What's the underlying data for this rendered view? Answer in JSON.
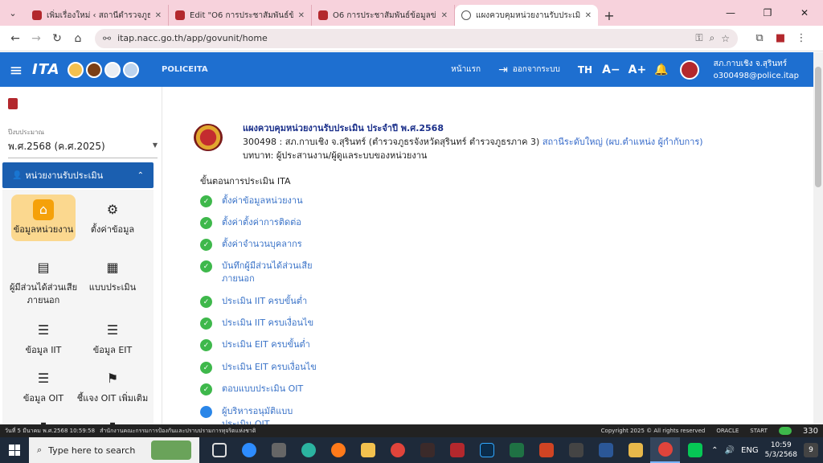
{
  "browser": {
    "tabs": [
      {
        "title": "เพิ่มเรื่องใหม่ ‹ สถานีตำรวจภูธรกาบเชิง",
        "active": false
      },
      {
        "title": "Edit \"O6 การประชาสัมพันธ์ข้อมูลข่าวสาร",
        "active": false
      },
      {
        "title": "O6 การประชาสัมพันธ์ข้อมูลข่าวสาร",
        "active": false
      },
      {
        "title": "แผงควบคุมหน่วยงานรับประเมิน - ITA",
        "active": true
      }
    ],
    "url": "itap.nacc.go.th/app/govunit/home"
  },
  "header": {
    "brand": "POLICEITA",
    "logo_text": "ITA",
    "home_link": "หน้าแรก",
    "logout_link": "ออกจากระบบ",
    "lang": "TH",
    "font_decrease": "A−",
    "font_increase": "A+",
    "user_name": "สภ.กาบเชิง จ.สุรินทร์",
    "user_email": "o300498@police.itap"
  },
  "sidebar": {
    "budget_label": "ปีงบประมาณ",
    "budget_value": "พ.ศ.2568 (ค.ศ.2025)",
    "panel_title": "หน่วยงานรับประเมิน",
    "items": [
      {
        "label": "ข้อมูลหน่วยงาน",
        "icon": "home-icon",
        "glyph": "⌂"
      },
      {
        "label": "ตั้งค่าข้อมูล",
        "icon": "settings-icon",
        "glyph": "⚙"
      },
      {
        "label": "ผู้มีส่วนได้ส่วนเสีย ภายนอก",
        "icon": "store-icon",
        "glyph": "▤"
      },
      {
        "label": "แบบประเมิน",
        "icon": "qr-icon",
        "glyph": "▦"
      },
      {
        "label": "ข้อมูล IIT",
        "icon": "checklist-icon",
        "glyph": "☰"
      },
      {
        "label": "ข้อมูล EIT",
        "icon": "checklist-icon",
        "glyph": "☰"
      },
      {
        "label": "ข้อมูล OIT",
        "icon": "checklist-icon",
        "glyph": "☰"
      },
      {
        "label": "ชี้แจง OIT เพิ่มเติม",
        "icon": "flag-icon",
        "glyph": "⚑"
      }
    ]
  },
  "main": {
    "title": "แผงควบคุมหน่วยงานรับประเมิน ประจำปี พ.ศ.2568",
    "unit_code_line": "300498 : สภ.กาบเชิง จ.สุรินทร์ (ตำรวจภูธรจังหวัดสุรินทร์ ตำรวจภูธรภาค 3)",
    "unit_type_link": "สถานีระดับใหญ่ (ผบ.ตำแหน่ง ผู้กำกับการ)",
    "role_line": "บทบาท: ผู้ประสานงาน/ผู้ดูแลระบบของหน่วยงาน",
    "steps_heading": "ขั้นตอนการประเมิน ITA",
    "steps": [
      {
        "label": "ตั้งค่าข้อมูลหน่วยงาน",
        "status": "done"
      },
      {
        "label": "ตั้งค่าตั้งค่าการติดต่อ",
        "status": "done"
      },
      {
        "label": "ตั้งค่าจำนวนบุคลากร",
        "status": "done"
      },
      {
        "label": "บันทึกผู้มีส่วนได้ส่วนเสีย ภายนอก",
        "status": "done"
      },
      {
        "label": "ประเมิน IIT ครบขั้นต่ำ",
        "status": "done"
      },
      {
        "label": "ประเมิน IIT ครบเงื่อนไข",
        "status": "done"
      },
      {
        "label": "ประเมิน EIT ครบขั้นต่ำ",
        "status": "done"
      },
      {
        "label": "ประเมิน EIT ครบเงื่อนไข",
        "status": "done"
      },
      {
        "label": "ตอบแบบประเมิน OIT",
        "status": "done"
      },
      {
        "label": "ผู้บริหารอนุมัติแบบประเมิน OIT",
        "status": "pending"
      }
    ]
  },
  "statusbar": {
    "left": "วันที่ 5 มีนาคม พ.ศ.2568 10:59:58",
    "org": "สำนักงานคณะกรรมการป้องกันและปราบปรามการทุจริตแห่งชาติ",
    "copyright": "Copyright 2025 © All rights reserved",
    "oracle": "ORACLE",
    "start": "START",
    "count": "330"
  },
  "taskbar": {
    "search_placeholder": "Type here to search",
    "lang": "ENG",
    "time": "10:59",
    "date": "5/3/2568",
    "notifications": "9"
  }
}
